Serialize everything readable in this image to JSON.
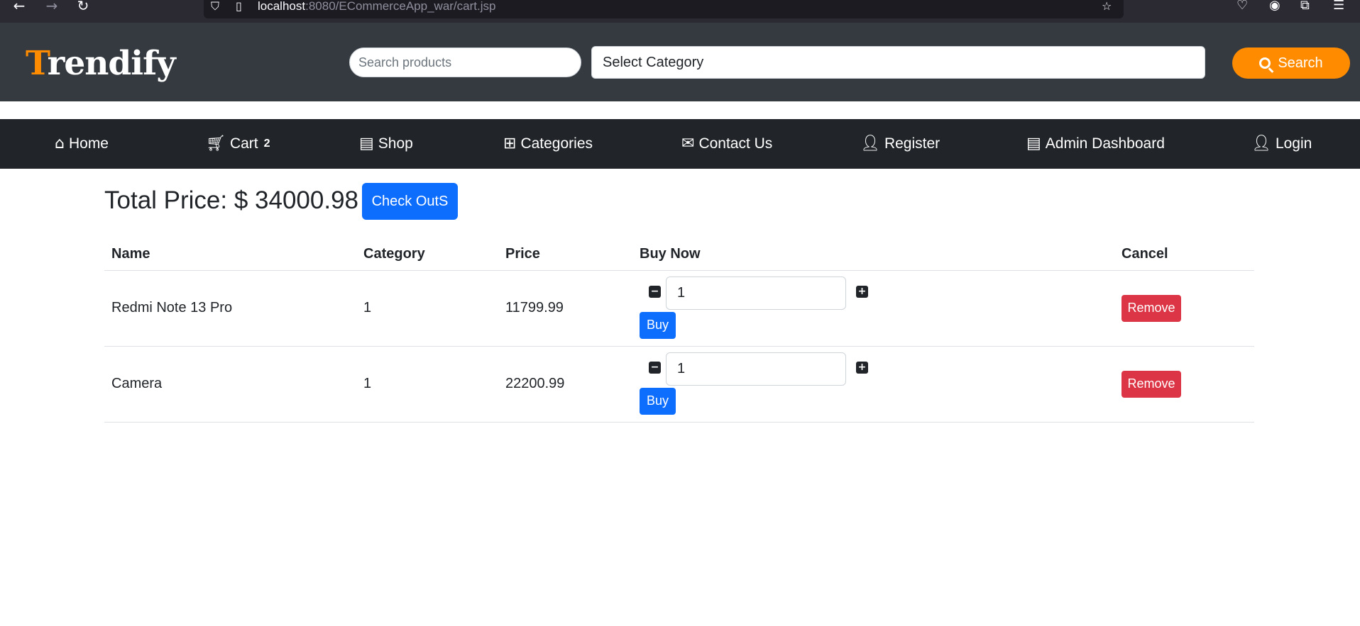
{
  "browser": {
    "url_host": "localhost",
    "url_path": ":8080/ECommerceApp_war/cart.jsp"
  },
  "header": {
    "logo_first": "T",
    "logo_rest": "rendify",
    "search_placeholder": "Search products",
    "category_select": "Select Category",
    "search_button": "Search",
    "brand_color": "#ff8c00"
  },
  "nav": {
    "items": [
      {
        "label": "Home",
        "icon": "home-icon"
      },
      {
        "label": "Cart",
        "icon": "cart-icon",
        "count": "2"
      },
      {
        "label": "Shop",
        "icon": "store-icon"
      },
      {
        "label": "Categories",
        "icon": "grid-icon"
      },
      {
        "label": "Contact Us",
        "icon": "envelope-icon"
      },
      {
        "label": "Register",
        "icon": "user-plus-icon"
      },
      {
        "label": "Admin Dashboard",
        "icon": "store-icon"
      },
      {
        "label": "Login",
        "icon": "user-icon"
      }
    ]
  },
  "cart": {
    "total_label": "Total Price: $ 34000.98",
    "checkout_button": "Check OutS",
    "columns": [
      "Name",
      "Category",
      "Price",
      "Buy Now",
      "Cancel"
    ],
    "rows": [
      {
        "name": "Redmi Note 13 Pro",
        "category": "1",
        "price": "11799.99",
        "quantity": "1",
        "buy": "Buy",
        "remove": "Remove"
      },
      {
        "name": "Camera",
        "category": "1",
        "price": "22200.99",
        "quantity": "1",
        "buy": "Buy",
        "remove": "Remove"
      }
    ]
  }
}
